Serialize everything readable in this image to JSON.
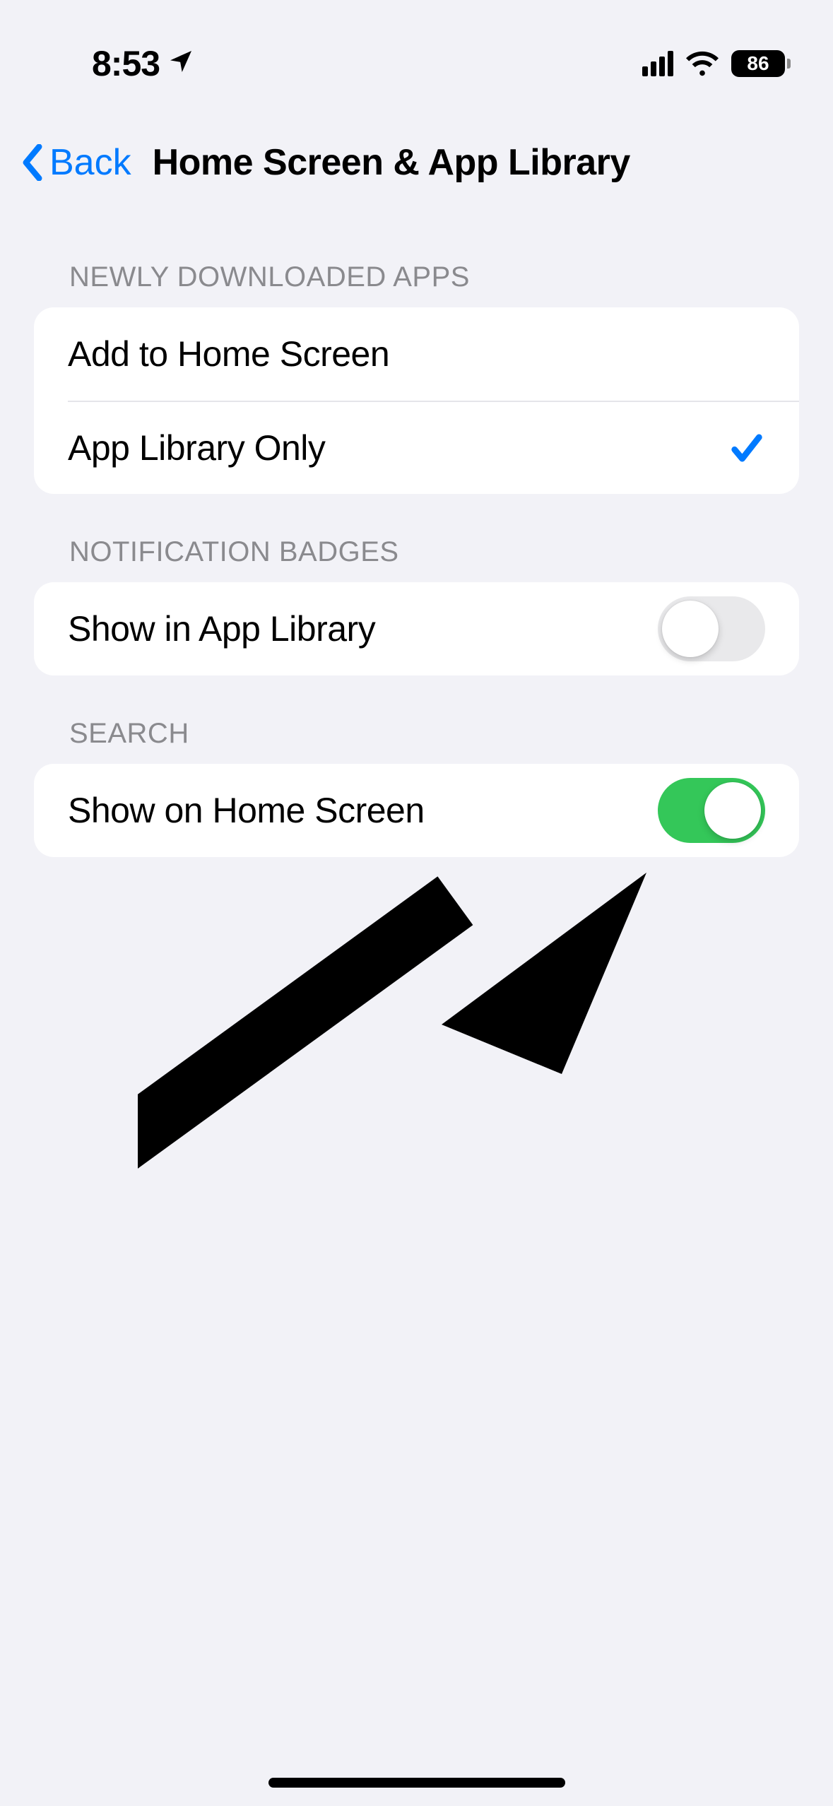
{
  "status": {
    "time": "8:53",
    "battery": "86"
  },
  "nav": {
    "back_label": "Back",
    "title": "Home Screen & App Library"
  },
  "sections": {
    "newly_downloaded": {
      "header": "NEWLY DOWNLOADED APPS",
      "options": {
        "add_home": "Add to Home Screen",
        "app_library_only": "App Library Only"
      },
      "selected": "app_library_only"
    },
    "notification_badges": {
      "header": "NOTIFICATION BADGES",
      "row_label": "Show in App Library",
      "value": false
    },
    "search": {
      "header": "SEARCH",
      "row_label": "Show on Home Screen",
      "value": true
    }
  }
}
